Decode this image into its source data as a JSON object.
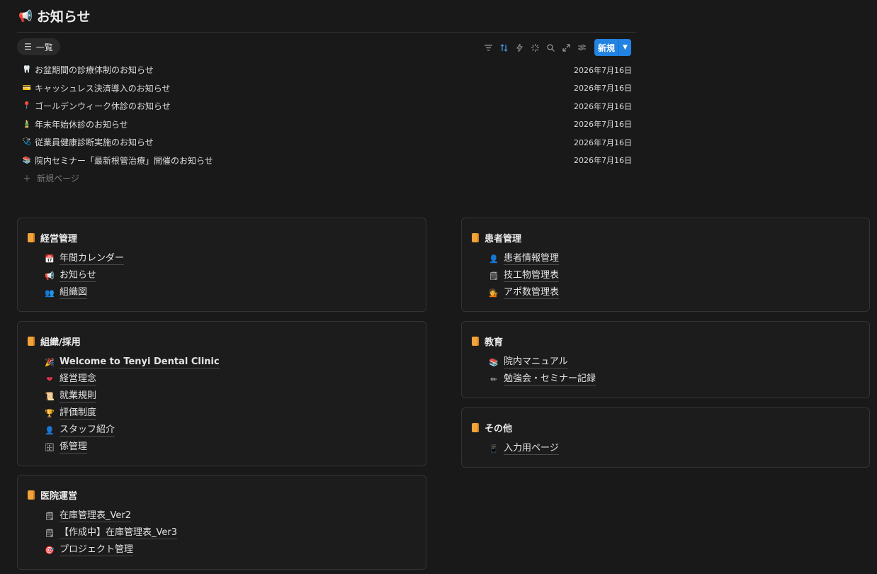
{
  "header": {
    "icon": "megaphone-icon",
    "title": "お知らせ"
  },
  "view": {
    "tab_label": "一覧",
    "new_button_label": "新規"
  },
  "notices": [
    {
      "icon": "🦷",
      "title": "お盆期間の診療体制のお知らせ",
      "date": "2026年7月16日"
    },
    {
      "icon": "💳",
      "title": "キャッシュレス決済導入のお知らせ",
      "date": "2026年7月16日"
    },
    {
      "icon": "📍",
      "title": "ゴールデンウィーク休診のお知らせ",
      "date": "2026年7月16日"
    },
    {
      "icon": "🎍",
      "title": "年末年始休診のお知らせ",
      "date": "2026年7月16日"
    },
    {
      "icon": "🩺",
      "title": "従業員健康診断実施のお知らせ",
      "date": "2026年7月16日"
    },
    {
      "icon": "📚",
      "title": "院内セミナー「最新根管治療」開催のお知らせ",
      "date": "2026年7月16日"
    }
  ],
  "new_page_label": "新規ページ",
  "sections": {
    "management": {
      "title": "経営管理",
      "items": [
        {
          "icon": "📅",
          "label": "年間カレンダー"
        },
        {
          "icon": "📢",
          "label": "お知らせ"
        },
        {
          "icon": "👥",
          "label": "組織図"
        }
      ]
    },
    "organization": {
      "title": "組織/採用",
      "items": [
        {
          "icon": "🎉",
          "label": "Welcome to Tenyi Dental Clinic"
        },
        {
          "icon": "❤",
          "label": "経営理念"
        },
        {
          "icon": "📜",
          "label": "就業規則"
        },
        {
          "icon": "🏆",
          "label": "評価制度"
        },
        {
          "icon": "👤",
          "label": "スタッフ紹介"
        },
        {
          "icon": "🗄",
          "label": "係管理"
        }
      ]
    },
    "clinic": {
      "title": "医院運営",
      "items": [
        {
          "icon": "🗒",
          "label": "在庫管理表_Ver2"
        },
        {
          "icon": "🗒",
          "label": "【作成中】在庫管理表_Ver3"
        },
        {
          "icon": "🎯",
          "label": "プロジェクト管理"
        }
      ]
    },
    "patients": {
      "title": "患者管理",
      "items": [
        {
          "icon": "👤",
          "label": "患者情報管理"
        },
        {
          "icon": "🗒",
          "label": "技工物管理表"
        },
        {
          "icon": "💁",
          "label": "アポ数管理表"
        }
      ]
    },
    "education": {
      "title": "教育",
      "items": [
        {
          "icon": "📚",
          "label": "院内マニュアル"
        },
        {
          "icon": "✏",
          "label": "勉強会・セミナー記録"
        }
      ]
    },
    "other": {
      "title": "その他",
      "items": [
        {
          "icon": "📱",
          "label": "入力用ページ"
        }
      ]
    }
  }
}
